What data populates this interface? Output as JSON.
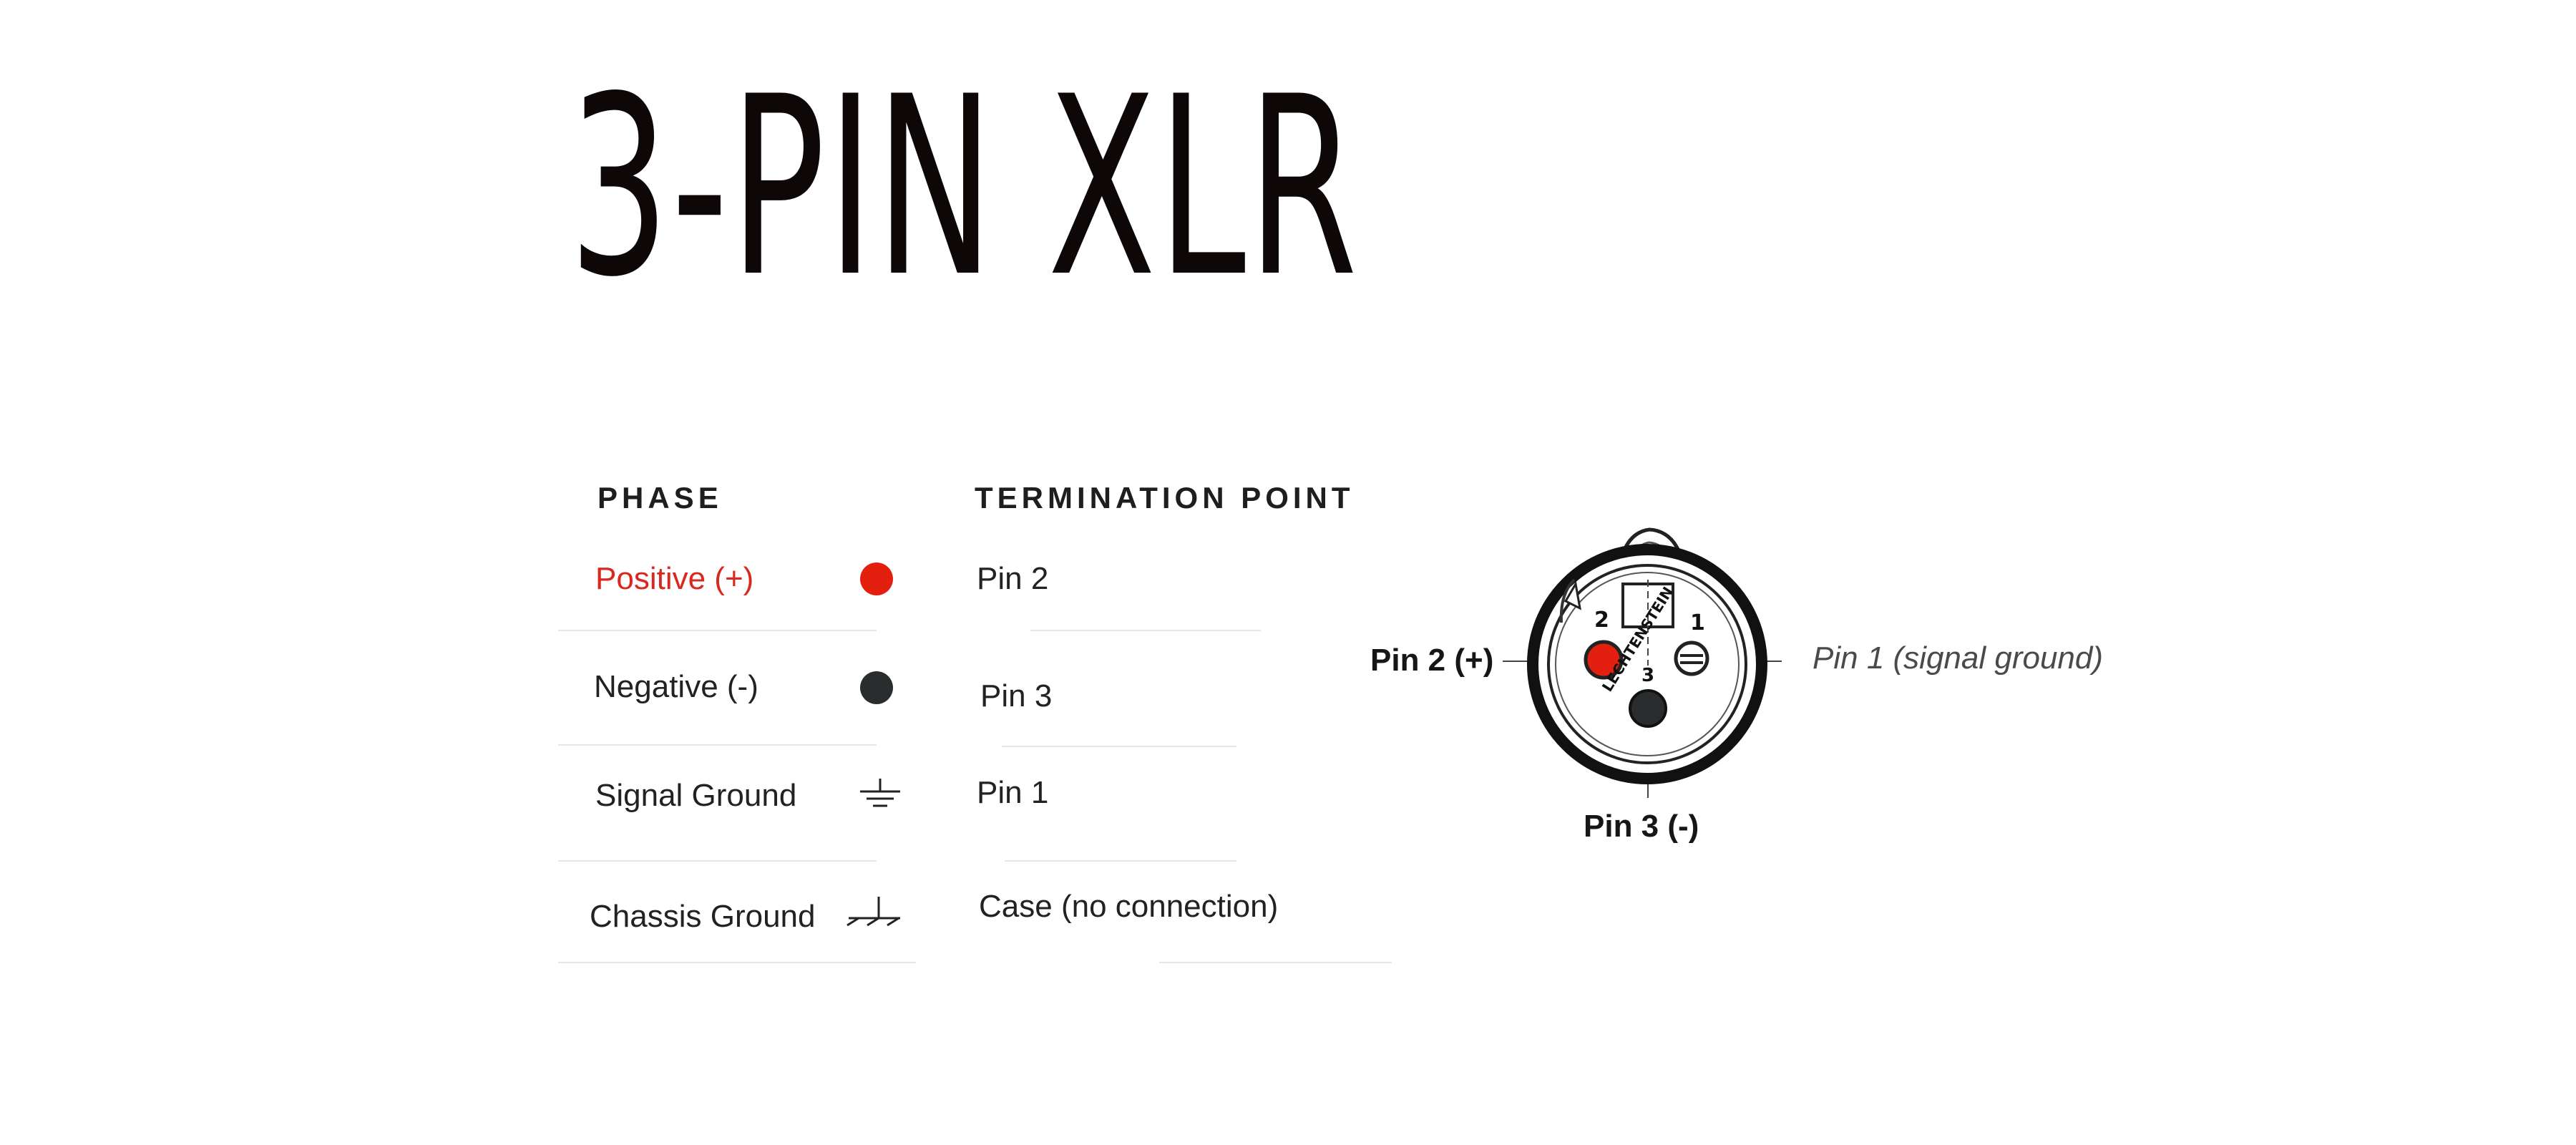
{
  "title": "3-PIN XLR",
  "table": {
    "phase_header": "PHASE",
    "termination_header": "TERMINATION POINT",
    "rows": [
      {
        "phase": "Positive (+)",
        "symbol": "red-dot-icon",
        "termination": "Pin 2"
      },
      {
        "phase": "Negative (-)",
        "symbol": "black-dot-icon",
        "termination": "Pin 3"
      },
      {
        "phase": "Signal Ground",
        "symbol": "signal-ground-icon",
        "termination": "Pin 1"
      },
      {
        "phase": "Chassis Ground",
        "symbol": "chassis-ground-icon",
        "termination": "Case (no connection)"
      }
    ]
  },
  "connector": {
    "pin2_label": "Pin 2 (+)",
    "pin1_label": "Pin 1 (signal ground)",
    "pin3_label": "Pin 3 (-)",
    "pin_numbers": [
      "2",
      "1",
      "3"
    ],
    "brand_text": "LECHTENSTEIN"
  },
  "colors": {
    "positive": "#e3200f",
    "negative": "#2a2d2d",
    "positive_text": "#d9281d"
  }
}
